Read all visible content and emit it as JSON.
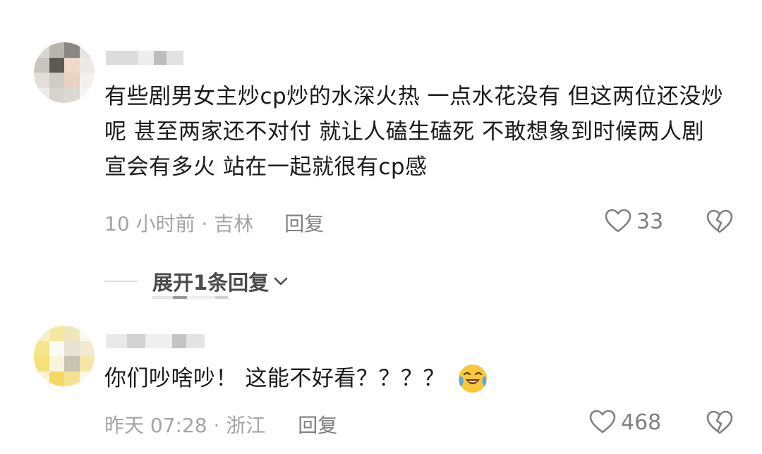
{
  "comments": [
    {
      "text": "有些剧男女主炒cp炒的水深火热 一点水花没有 但这两位还没炒呢 甚至两家还不对付 就让人磕生磕死 不敢想象到时候两人剧宣会有多火 站在一起就很有cp感",
      "time_location": "10 小时前 · 吉林",
      "reply_label": "回复",
      "like_count": "33",
      "avatar_icon": "pixelated-avatar-icon"
    },
    {
      "text": "你们吵啥吵！ 这能不好看？？？？",
      "emoji": "crying-laughing-emoji",
      "time_location": "昨天 07:28 · 浙江",
      "reply_label": "回复",
      "like_count": "468",
      "avatar_icon": "pixelated-avatar-icon"
    }
  ],
  "expand_replies_label": "展开1条回复",
  "colors": {
    "text": "#1a1a1a",
    "meta": "#a4a4a4",
    "icon": "#808080",
    "emoji_yellow": "#f6c83a"
  }
}
